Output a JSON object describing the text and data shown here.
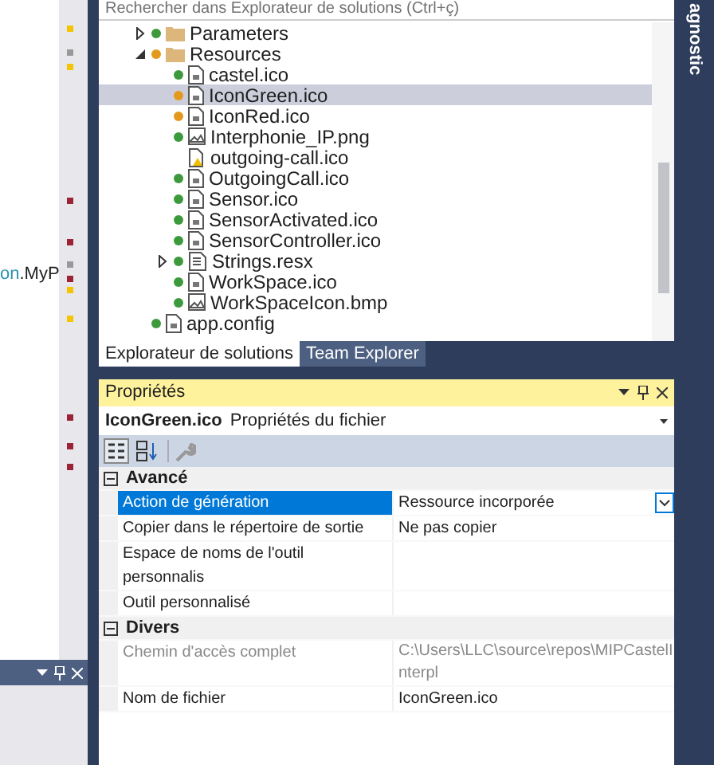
{
  "code_fragment": [
    {
      "text": "on",
      "kind": "type"
    },
    {
      "text": ".MyP",
      "kind": "plain"
    }
  ],
  "search": {
    "placeholder": "Rechercher dans Explorateur de solutions (Ctrl+ç)"
  },
  "tree": [
    {
      "label": "Parameters",
      "kind": "folder",
      "color": "#3c9a3c",
      "expanded": false,
      "selected": false
    },
    {
      "label": "Resources",
      "kind": "folder",
      "color": "#e39a1c",
      "expanded": true,
      "selected": false,
      "children": [
        {
          "label": "castel.ico",
          "kind": "file",
          "color": "#3c9a3c",
          "selected": false
        },
        {
          "label": "IconGreen.ico",
          "kind": "file",
          "color": "#e39a1c",
          "selected": true
        },
        {
          "label": "IconRed.ico",
          "kind": "file",
          "color": "#e39a1c",
          "selected": false
        },
        {
          "label": "Interphonie_IP.png",
          "kind": "image",
          "color": "#3c9a3c",
          "selected": false
        },
        {
          "label": "outgoing-call.ico",
          "kind": "missing",
          "selected": false
        },
        {
          "label": "OutgoingCall.ico",
          "kind": "file",
          "color": "#3c9a3c",
          "selected": false
        },
        {
          "label": "Sensor.ico",
          "kind": "file",
          "color": "#3c9a3c",
          "selected": false
        },
        {
          "label": "SensorActivated.ico",
          "kind": "file",
          "color": "#3c9a3c",
          "selected": false
        },
        {
          "label": "SensorController.ico",
          "kind": "file",
          "color": "#3c9a3c",
          "selected": false
        },
        {
          "label": "Strings.resx",
          "kind": "resx",
          "color": "#3c9a3c",
          "expanded": false,
          "selected": false
        },
        {
          "label": "WorkSpace.ico",
          "kind": "file",
          "color": "#3c9a3c",
          "selected": false
        },
        {
          "label": "WorkSpaceIcon.bmp",
          "kind": "image",
          "color": "#3c9a3c",
          "selected": false
        }
      ]
    },
    {
      "label": "app.config",
      "kind": "file",
      "color": "#3c9a3c",
      "selected": false
    }
  ],
  "tabs": [
    {
      "label": "Explorateur de solutions",
      "selected": true
    },
    {
      "label": "Team Explorer",
      "selected": false
    }
  ],
  "side_tab": {
    "label": "agnostic"
  },
  "properties": {
    "title": "Propriétés",
    "object_name": "IconGreen.ico",
    "object_type": "Propriétés du fichier",
    "categories": [
      {
        "name": "Avancé",
        "expanded": true,
        "rows": [
          {
            "name": "Action de génération",
            "value": "Ressource incorporée",
            "selected": true,
            "disabled": false
          },
          {
            "name": "Copier dans le répertoire de sortie",
            "value": "Ne pas copier",
            "selected": false,
            "disabled": false
          },
          {
            "name": "Espace de noms de l'outil personnalis",
            "selected": false,
            "disabled": false
          },
          {
            "name": "Outil personnalisé",
            "selected": false,
            "disabled": false
          }
        ]
      },
      {
        "name": "Divers",
        "expanded": true,
        "rows": [
          {
            "name": "Chemin d'accès complet",
            "value": "C:\\Users\\LLC\\source\\repos\\MIPCastelInterpl",
            "selected": false,
            "disabled": true
          },
          {
            "name": "Nom de fichier",
            "value": "IconGreen.ico",
            "selected": false,
            "disabled": false
          }
        ]
      }
    ]
  }
}
